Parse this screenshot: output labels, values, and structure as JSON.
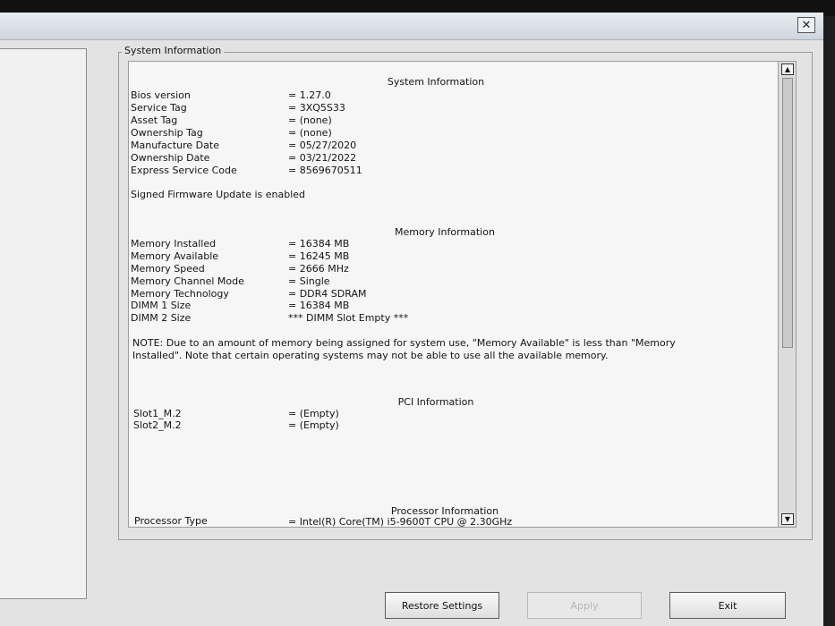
{
  "window": {
    "close_symbol": "✕"
  },
  "groupbox": {
    "title": "System Information"
  },
  "system": {
    "header": "System Information",
    "rows": [
      {
        "label": "Bios version",
        "value": "= 1.27.0"
      },
      {
        "label": "Service Tag",
        "value": "= 3XQ5S33"
      },
      {
        "label": "Asset Tag",
        "value": "= (none)"
      },
      {
        "label": "Ownership Tag",
        "value": "= (none)"
      },
      {
        "label": "Manufacture Date",
        "value": "= 05/27/2020"
      },
      {
        "label": "Ownership Date",
        "value": "= 03/21/2022"
      },
      {
        "label": "Express Service Code",
        "value": "= 8569670511"
      }
    ],
    "firmware_note": "Signed Firmware Update is enabled"
  },
  "memory": {
    "header": "Memory Information",
    "rows": [
      {
        "label": "Memory Installed",
        "value": "= 16384 MB"
      },
      {
        "label": "Memory Available",
        "value": "= 16245 MB"
      },
      {
        "label": "Memory Speed",
        "value": "= 2666 MHz"
      },
      {
        "label": "Memory Channel Mode",
        "value": "= Single"
      },
      {
        "label": "Memory Technology",
        "value": "= DDR4 SDRAM"
      },
      {
        "label": "DIMM 1 Size",
        "value": "= 16384 MB"
      },
      {
        "label": "DIMM 2 Size",
        "value": "*** DIMM Slot Empty ***"
      }
    ],
    "note": "NOTE: Due to an amount of memory being assigned for system use, \"Memory Available\" is less than \"Memory Installed\". Note that certain operating systems may not be able to use all the available memory."
  },
  "pci": {
    "header": "PCI Information",
    "rows": [
      {
        "label": "Slot1_M.2",
        "value": "= (Empty)"
      },
      {
        "label": "Slot2_M.2",
        "value": "= (Empty)"
      }
    ]
  },
  "processor": {
    "header": "Processor Information",
    "rows": [
      {
        "label": "Processor Type",
        "value": "= Intel(R) Core(TM) i5-9600T CPU @ 2.30GHz"
      }
    ]
  },
  "scrollbar": {
    "up_symbol": "▲",
    "down_symbol": "▼"
  },
  "buttons": {
    "restore": "Restore Settings",
    "apply": "Apply",
    "exit": "Exit"
  }
}
